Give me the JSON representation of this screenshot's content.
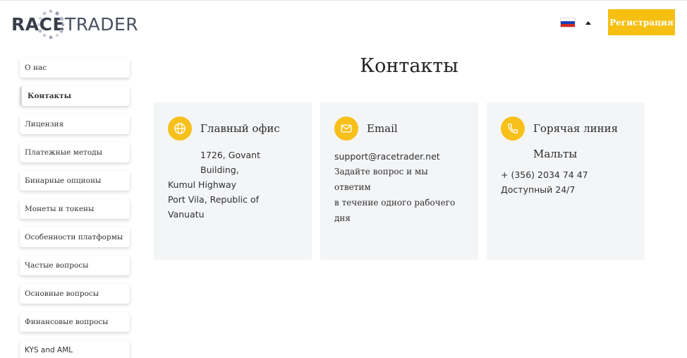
{
  "header": {
    "logo": {
      "part1": "RACE",
      "part2": "TRADER"
    },
    "register_label": "Регистрация",
    "flag_colors": [
      "#ffffff",
      "#1c3fb8",
      "#d52b1e"
    ]
  },
  "sidebar": {
    "items": [
      {
        "label": "О нас",
        "active": false
      },
      {
        "label": "Контакты",
        "active": true
      },
      {
        "label": "Лицензия",
        "active": false
      },
      {
        "label": "Платежные методы",
        "active": false
      },
      {
        "label": "Бинарные опционы",
        "active": false
      },
      {
        "label": "Монеты и токены",
        "active": false
      },
      {
        "label": "Особенности платформы",
        "active": false
      },
      {
        "label": "Частые вопросы",
        "active": false
      },
      {
        "label": "Основные вопросы",
        "active": false
      },
      {
        "label": "Финансовые вопросы",
        "active": false
      },
      {
        "label": "KYS and AML",
        "active": false
      }
    ]
  },
  "main": {
    "title": "Контакты",
    "office": {
      "icon": "globe-icon",
      "title": "Главный офис",
      "address_lines": [
        "1726, Govant Building,",
        "Kumul Highway",
        "Port Vila, Republic of",
        "Vanuatu"
      ]
    },
    "email": {
      "icon": "mail-icon",
      "title": "Email",
      "address": "support@racetrader.net",
      "note_lines": [
        "Задайте вопрос и мы ответим",
        "в течение одного рабочего дня"
      ]
    },
    "hotline": {
      "icon": "phone-icon",
      "title_line1": "Горячая линия",
      "title_line2": "Мальты",
      "phone": "+ (356) 2034 74 47",
      "availability": "Доступный 24/7"
    }
  },
  "colors": {
    "accent": "#f6c012",
    "card_bg": "#f4f5f7"
  }
}
